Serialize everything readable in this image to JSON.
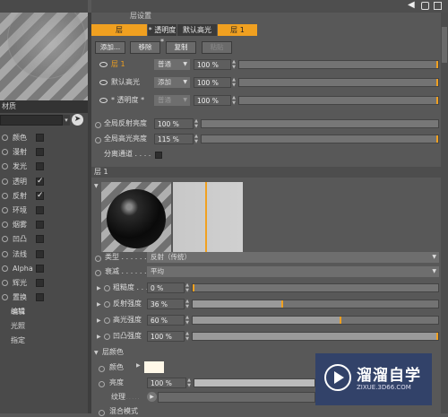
{
  "header": {
    "title": "层设置",
    "back_arrow": "◀"
  },
  "left": {
    "material_label": "材质",
    "channels": [
      {
        "label": "颜色",
        "checked": false
      },
      {
        "label": "漫射",
        "checked": false
      },
      {
        "label": "发光",
        "checked": false
      },
      {
        "label": "透明",
        "checked": true
      },
      {
        "label": "反射",
        "checked": true
      },
      {
        "label": "环境",
        "checked": false
      },
      {
        "label": "烟雾",
        "checked": false
      },
      {
        "label": "凹凸",
        "checked": false
      },
      {
        "label": "法线",
        "checked": false
      },
      {
        "label": "Alpha",
        "checked": false
      },
      {
        "label": "辉光",
        "checked": false
      },
      {
        "label": "置换",
        "checked": false
      }
    ],
    "sub_items": [
      "编辑",
      "光照",
      "指定"
    ]
  },
  "tabs": [
    "层",
    "* 透明度 *",
    "默认高光",
    "层 1"
  ],
  "buttons": {
    "add": "添加...",
    "remove": "移除",
    "copy": "复制",
    "paste": "粘贴"
  },
  "layers": [
    {
      "name": "层 1",
      "mode": "普通",
      "value": "100 %"
    },
    {
      "name": "默认高光",
      "mode": "添加",
      "value": "100 %"
    },
    {
      "name": "* 透明度 *",
      "mode": "普通",
      "value": "100 %"
    }
  ],
  "global": {
    "reflect_label": "全局反射亮度",
    "reflect_value": "100 %",
    "spec_label": "全局高光亮度",
    "spec_value": "115 %",
    "separate_label": "分离通道 . . . ."
  },
  "layer_section": {
    "title": "层 1"
  },
  "props": {
    "type_label": "类型 . . . . . . . .",
    "type_value": "反射（传统）",
    "atten_label": "衰减 . . . . . . . .",
    "atten_value": "平均",
    "rough_label": "粗糙度 . . .",
    "rough_value": "0 %",
    "refl_label": "反射强度",
    "refl_value": "36 %",
    "spec_label": "高光强度",
    "spec_value": "60 %",
    "bump_label": "凹凸强度",
    "bump_value": "100 %"
  },
  "color_section": {
    "title": "层颜色",
    "color_label": "颜色",
    "bright_label": "亮度",
    "bright_value": "100 %",
    "texture_label": "纹理",
    "blend_label": "混合模式"
  },
  "watermark": {
    "title": "溜溜自学",
    "subtitle": "ZIXUE.3D66.COM"
  },
  "colors": {
    "accent": "#f0a020",
    "swatch": "#fff8e8"
  }
}
